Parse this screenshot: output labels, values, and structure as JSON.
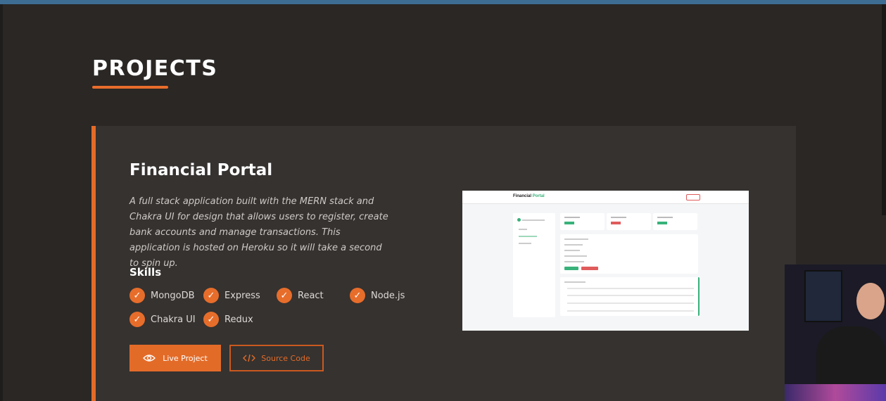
{
  "section": {
    "title": "PROJECTS"
  },
  "project": {
    "title": "Financial Portal",
    "description": "A full stack application built with the MERN stack and Chakra UI for design that allows users to register, create bank accounts and manage transactions. This application is hosted on Heroku so it will take a second to spin up.",
    "skills_heading": "Skills",
    "skills": [
      "MongoDB",
      "Express",
      "React",
      "Node.js",
      "Chakra UI",
      "Redux"
    ],
    "buttons": {
      "live": "Live Project",
      "source": "Source Code"
    },
    "screenshot": {
      "brand_first": "Financial",
      "brand_second": "Portal"
    }
  },
  "colors": {
    "accent": "#e36b28",
    "background": "#2a2725",
    "card": "#353230",
    "success": "#38b27a"
  },
  "icons": {
    "check": "check-icon",
    "eye": "eye-icon",
    "code": "code-icon"
  }
}
